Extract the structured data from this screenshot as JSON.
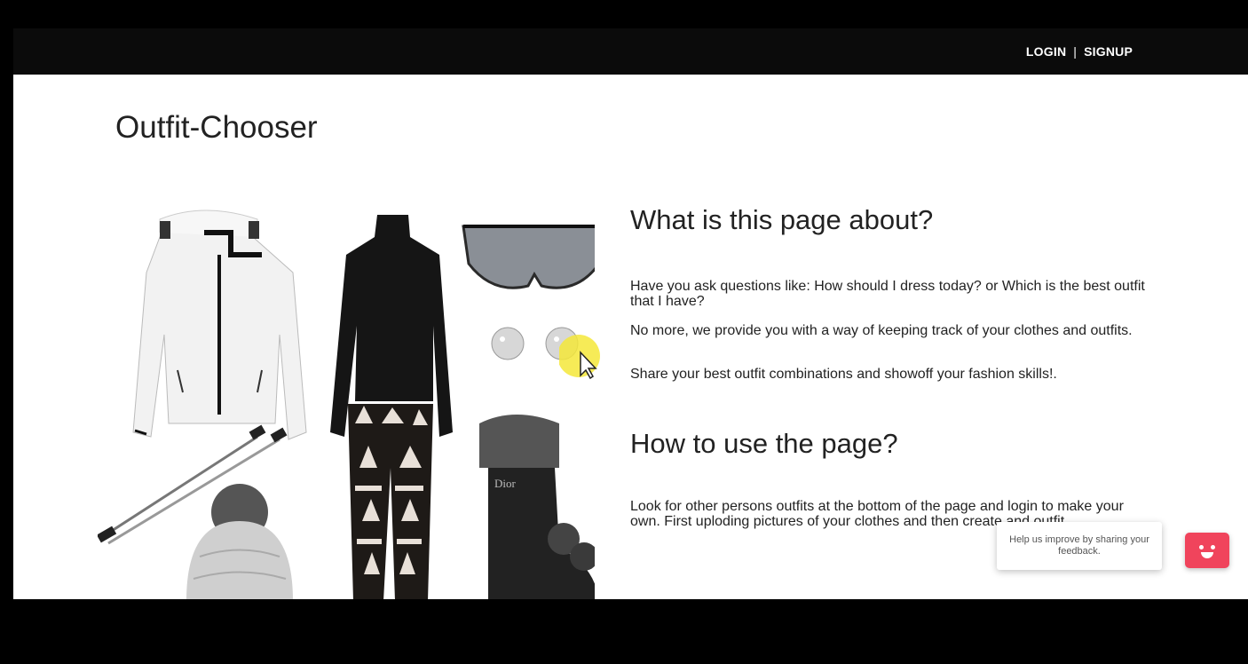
{
  "nav": {
    "login": "LOGIN",
    "separator": "|",
    "signup": "SIGNUP"
  },
  "site_title": "Outfit-Chooser",
  "about": {
    "heading": "What is this page about?",
    "paragraphs": [
      "Have you ask questions like: How should I dress today? or Which is the best outfit that I have?",
      "No more, we provide you with a way of keeping track of your clothes and outfits.",
      "Share your best outfit combinations and showoff your fashion skills!."
    ]
  },
  "howto": {
    "heading": "How to use the page?",
    "paragraph": "Look for other persons outfits at the bottom of the page and login to make your own. First uploding pictures of your clothes and then create and outfit."
  },
  "feedback": {
    "text": "Help us improve by sharing your feedback."
  },
  "collage": {
    "items": [
      "white puffer jacket",
      "black turtleneck",
      "sunglasses",
      "earrings",
      "printed leggings",
      "fur boot",
      "ski poles",
      "knit pom-pom hat"
    ],
    "boot_brand": "Dior"
  },
  "colors": {
    "feedback_accent": "#f0445c",
    "navbar": "#0b0b0b",
    "cursor_highlight": "#f5e83a"
  }
}
